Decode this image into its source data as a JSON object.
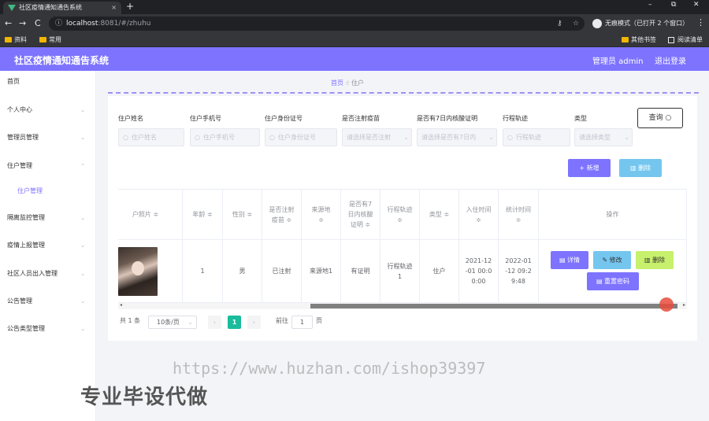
{
  "browser": {
    "tab_title": "社区疫情通知通告系统",
    "tab_close": "×",
    "new_tab": "+",
    "window_controls": [
      "–",
      "⧉",
      "✕"
    ],
    "nav": {
      "back": "←",
      "forward": "→",
      "reload": "C"
    },
    "url_host": "localhost",
    "url_path": ":8081/#/zhuhu",
    "omni_icons": {
      "key": "⚷",
      "star": "☆"
    },
    "incognito_label": "无痕模式（已打开 2 个窗口）",
    "menu": "⋮",
    "bookmarks": [
      "资料",
      "常用"
    ],
    "bookmarks_right": [
      "其他书签",
      "阅读清单"
    ]
  },
  "app": {
    "title": "社区疫情通知通告系统",
    "admin_label": "管理员 admin",
    "logout_label": "退出登录",
    "accent_color": "#7d73ff"
  },
  "sidebar": {
    "items": [
      {
        "label": "首页",
        "arrow": ""
      },
      {
        "label": "个人中心",
        "arrow": "⌄"
      },
      {
        "label": "管理员管理",
        "arrow": "⌄"
      },
      {
        "label": "住户管理",
        "arrow": "⌃"
      },
      {
        "label": "住户管理",
        "arrow": ""
      },
      {
        "label": "隔离监控管理",
        "arrow": "⌄"
      },
      {
        "label": "疫情上报管理",
        "arrow": "⌄"
      },
      {
        "label": "社区人员出入管理",
        "arrow": "⌄"
      },
      {
        "label": "公告管理",
        "arrow": "⌄"
      },
      {
        "label": "公告类型管理",
        "arrow": "⌄"
      }
    ]
  },
  "breadcrumb": {
    "home": "首页",
    "sep": "☝",
    "current": "住户"
  },
  "filters": {
    "labels": [
      "住户姓名",
      "住户手机号",
      "住户身份证号",
      "是否注射疫苗",
      "是否有7日内核酸证明",
      "行程轨迹",
      "类型"
    ],
    "name_placeholder": "住户姓名",
    "phone_placeholder": "住户手机号",
    "idcard_placeholder": "住户身份证号",
    "vaccine_placeholder": "请选择是否注射",
    "nucleic_placeholder": "请选择是否有7日内",
    "track_placeholder": "行程轨迹",
    "type_placeholder": "请选择类型",
    "search_icon": "○",
    "chevron": "⌄",
    "query_label": "查询 ○"
  },
  "actions": {
    "add_label": "+ 新增",
    "delete_label": "▥ 删除"
  },
  "table": {
    "headers": [
      "户照片 ≑",
      "年龄 ≑",
      "性别 ≑",
      "是否注射疫苗 ≑",
      "来源地 ≑",
      "是否有7日内核酸证明 ≑",
      "行程轨迹 ≑",
      "类型 ≑",
      "入住时间 ≑",
      "统计时间 ≑",
      "操作"
    ],
    "header_lines": [
      [
        "户照片 ≑"
      ],
      [
        "年龄 ≑"
      ],
      [
        "性别 ≑"
      ],
      [
        "是否注射",
        "疫苗 ≑"
      ],
      [
        "来源地",
        "≑"
      ],
      [
        "是否有7",
        "日内核酸",
        "证明 ≑"
      ],
      [
        "行程轨迹",
        "≑"
      ],
      [
        "类型 ≑"
      ],
      [
        "入住时间",
        "≑"
      ],
      [
        "统计时间",
        "≑"
      ],
      [
        "操作"
      ]
    ],
    "rows": [
      {
        "photo_icon": "portrait-photo",
        "age": "1",
        "gender": "男",
        "vaccinated": "已注射",
        "origin": "来源地1",
        "nucleic": "有证明",
        "track": [
          "行程轨迹",
          "1"
        ],
        "type": "住户",
        "checkin": [
          "2021-12",
          "-01 00:0",
          "0:00"
        ],
        "stat_time": [
          "2022-01",
          "-12 09:2",
          "9:48"
        ],
        "btn_detail": "▤ 详情",
        "btn_edit": "✎ 修改",
        "btn_delete": "▥ 删除",
        "btn_resetpw": "▤ 重置密码"
      }
    ]
  },
  "pagination": {
    "total": "共 1 条",
    "page_size": "10条/页",
    "prev": "‹",
    "current_page": "1",
    "next": "›",
    "goto_label": "前往",
    "goto_value": "1",
    "goto_suffix": "页"
  },
  "scroll": {
    "left_arrow": "◂",
    "right_arrow": "▸"
  },
  "watermark": "https://www.huzhan.com/ishop39397",
  "overlay_text": "专业毕设代做"
}
